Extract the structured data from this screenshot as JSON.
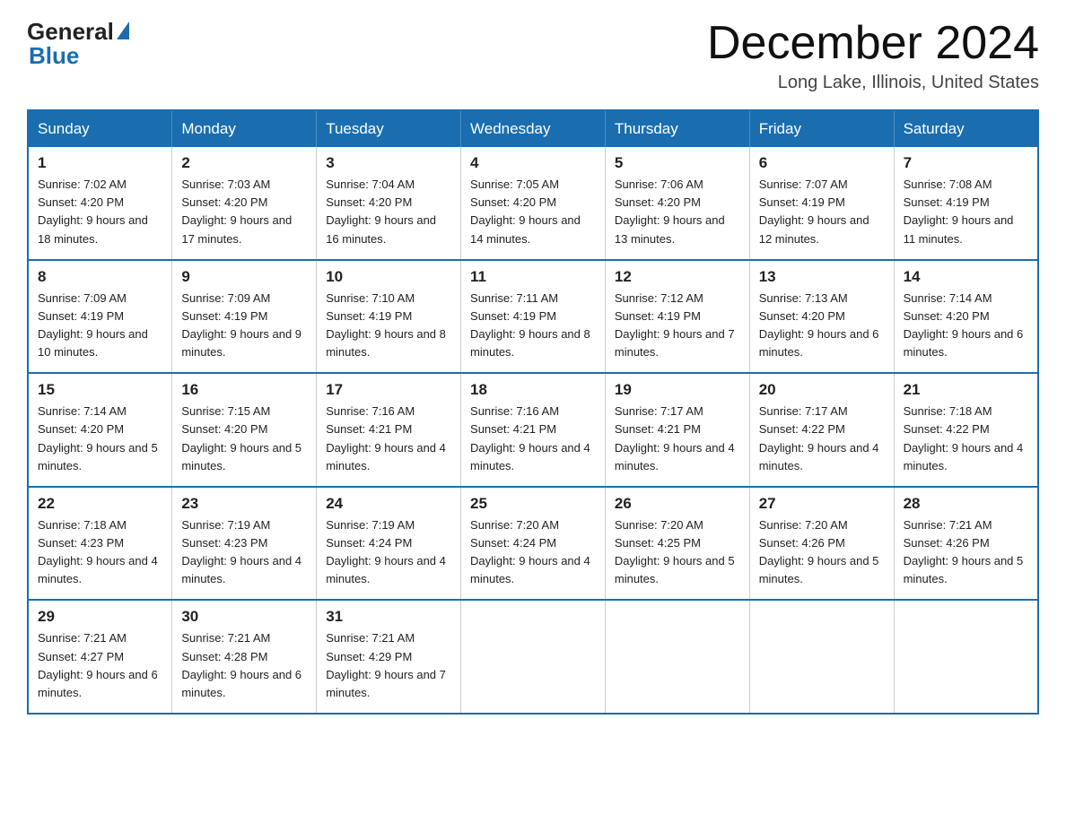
{
  "logo": {
    "general": "General",
    "blue": "Blue"
  },
  "title": "December 2024",
  "location": "Long Lake, Illinois, United States",
  "days_of_week": [
    "Sunday",
    "Monday",
    "Tuesday",
    "Wednesday",
    "Thursday",
    "Friday",
    "Saturday"
  ],
  "weeks": [
    [
      {
        "day": "1",
        "sunrise": "7:02 AM",
        "sunset": "4:20 PM",
        "daylight": "9 hours and 18 minutes."
      },
      {
        "day": "2",
        "sunrise": "7:03 AM",
        "sunset": "4:20 PM",
        "daylight": "9 hours and 17 minutes."
      },
      {
        "day": "3",
        "sunrise": "7:04 AM",
        "sunset": "4:20 PM",
        "daylight": "9 hours and 16 minutes."
      },
      {
        "day": "4",
        "sunrise": "7:05 AM",
        "sunset": "4:20 PM",
        "daylight": "9 hours and 14 minutes."
      },
      {
        "day": "5",
        "sunrise": "7:06 AM",
        "sunset": "4:20 PM",
        "daylight": "9 hours and 13 minutes."
      },
      {
        "day": "6",
        "sunrise": "7:07 AM",
        "sunset": "4:19 PM",
        "daylight": "9 hours and 12 minutes."
      },
      {
        "day": "7",
        "sunrise": "7:08 AM",
        "sunset": "4:19 PM",
        "daylight": "9 hours and 11 minutes."
      }
    ],
    [
      {
        "day": "8",
        "sunrise": "7:09 AM",
        "sunset": "4:19 PM",
        "daylight": "9 hours and 10 minutes."
      },
      {
        "day": "9",
        "sunrise": "7:09 AM",
        "sunset": "4:19 PM",
        "daylight": "9 hours and 9 minutes."
      },
      {
        "day": "10",
        "sunrise": "7:10 AM",
        "sunset": "4:19 PM",
        "daylight": "9 hours and 8 minutes."
      },
      {
        "day": "11",
        "sunrise": "7:11 AM",
        "sunset": "4:19 PM",
        "daylight": "9 hours and 8 minutes."
      },
      {
        "day": "12",
        "sunrise": "7:12 AM",
        "sunset": "4:19 PM",
        "daylight": "9 hours and 7 minutes."
      },
      {
        "day": "13",
        "sunrise": "7:13 AM",
        "sunset": "4:20 PM",
        "daylight": "9 hours and 6 minutes."
      },
      {
        "day": "14",
        "sunrise": "7:14 AM",
        "sunset": "4:20 PM",
        "daylight": "9 hours and 6 minutes."
      }
    ],
    [
      {
        "day": "15",
        "sunrise": "7:14 AM",
        "sunset": "4:20 PM",
        "daylight": "9 hours and 5 minutes."
      },
      {
        "day": "16",
        "sunrise": "7:15 AM",
        "sunset": "4:20 PM",
        "daylight": "9 hours and 5 minutes."
      },
      {
        "day": "17",
        "sunrise": "7:16 AM",
        "sunset": "4:21 PM",
        "daylight": "9 hours and 4 minutes."
      },
      {
        "day": "18",
        "sunrise": "7:16 AM",
        "sunset": "4:21 PM",
        "daylight": "9 hours and 4 minutes."
      },
      {
        "day": "19",
        "sunrise": "7:17 AM",
        "sunset": "4:21 PM",
        "daylight": "9 hours and 4 minutes."
      },
      {
        "day": "20",
        "sunrise": "7:17 AM",
        "sunset": "4:22 PM",
        "daylight": "9 hours and 4 minutes."
      },
      {
        "day": "21",
        "sunrise": "7:18 AM",
        "sunset": "4:22 PM",
        "daylight": "9 hours and 4 minutes."
      }
    ],
    [
      {
        "day": "22",
        "sunrise": "7:18 AM",
        "sunset": "4:23 PM",
        "daylight": "9 hours and 4 minutes."
      },
      {
        "day": "23",
        "sunrise": "7:19 AM",
        "sunset": "4:23 PM",
        "daylight": "9 hours and 4 minutes."
      },
      {
        "day": "24",
        "sunrise": "7:19 AM",
        "sunset": "4:24 PM",
        "daylight": "9 hours and 4 minutes."
      },
      {
        "day": "25",
        "sunrise": "7:20 AM",
        "sunset": "4:24 PM",
        "daylight": "9 hours and 4 minutes."
      },
      {
        "day": "26",
        "sunrise": "7:20 AM",
        "sunset": "4:25 PM",
        "daylight": "9 hours and 5 minutes."
      },
      {
        "day": "27",
        "sunrise": "7:20 AM",
        "sunset": "4:26 PM",
        "daylight": "9 hours and 5 minutes."
      },
      {
        "day": "28",
        "sunrise": "7:21 AM",
        "sunset": "4:26 PM",
        "daylight": "9 hours and 5 minutes."
      }
    ],
    [
      {
        "day": "29",
        "sunrise": "7:21 AM",
        "sunset": "4:27 PM",
        "daylight": "9 hours and 6 minutes."
      },
      {
        "day": "30",
        "sunrise": "7:21 AM",
        "sunset": "4:28 PM",
        "daylight": "9 hours and 6 minutes."
      },
      {
        "day": "31",
        "sunrise": "7:21 AM",
        "sunset": "4:29 PM",
        "daylight": "9 hours and 7 minutes."
      },
      null,
      null,
      null,
      null
    ]
  ]
}
